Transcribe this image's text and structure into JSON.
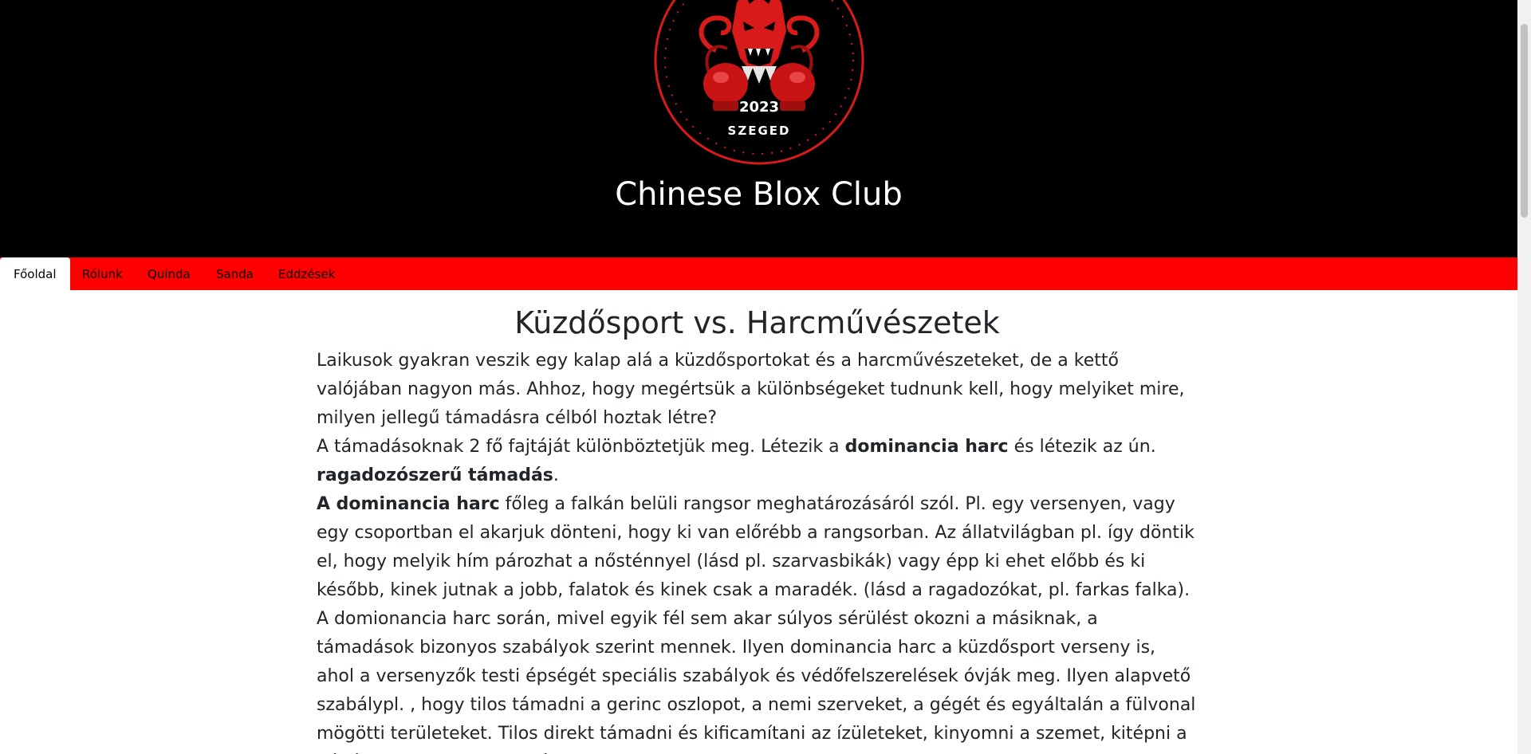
{
  "header": {
    "logo": {
      "year": "2023",
      "city": "SZEGED"
    },
    "site_title": "Chinese Blox Club"
  },
  "nav": {
    "tabs": [
      {
        "label": "Főoldal",
        "active": true
      },
      {
        "label": "Rólunk"
      },
      {
        "label": "Quinda"
      },
      {
        "label": "Sanda"
      },
      {
        "label": "Eddzések"
      }
    ]
  },
  "article": {
    "title": "Küzdősport vs. Harcművészetek",
    "p1": "Laikusok gyakran veszik egy kalap alá a küzdősportokat és a harcművészeteket, de a kettő valójában nagyon más. Ahhoz, hogy megértsük a különbségeket tudnunk kell, hogy melyiket mire, milyen jellegű támadásra célból hoztak létre?",
    "p2": {
      "before": "A támadásoknak 2 fő fajtáját különböztetjük meg. Létezik a ",
      "strong1": "dominancia harc",
      "middle": " és létezik az ún. ",
      "strong2": "ragadozószerű támadás",
      "after": "."
    },
    "p3": {
      "strong": "A dominancia harc",
      "text": " főleg a falkán belüli rangsor meghatározásáról szól. Pl. egy versenyen, vagy egy csoportban el akarjuk dönteni, hogy ki van előrébb a rangsorban. Az állatvilágban pl. így döntik el, hogy melyik hím pározhat a nősténnyel (lásd pl. szarvasbikák) vagy épp ki ehet előbb és ki később, kinek jutnak a jobb, falatok és kinek csak a maradék. (lásd a ragadozókat, pl. farkas falka)."
    },
    "p4": "A domionancia harc során, mivel egyik fél sem akar súlyos sérülést okozni a másiknak, a támadások bizonyos szabályok szerint mennek. Ilyen dominancia harc a küzdősport verseny is, ahol a versenyzők testi épségét speciális szabályok és védőfelszerelések óvják meg. Ilyen alapvető szabálypl. , hogy tilos támadni a gerinc oszlopot, a nemi szerveket, a gégét és egyáltalán a fülvonal mögötti területeket. Tilos direkt támadni és kificamítani az ízületeket, kinyomni a szemet, kitépni a gégét, stb. Mivel a lehetséges"
  },
  "colors": {
    "header_bg": "#000000",
    "nav_bg": "#ff0000",
    "logo_red": "#d91a1a",
    "text": "#212529"
  }
}
